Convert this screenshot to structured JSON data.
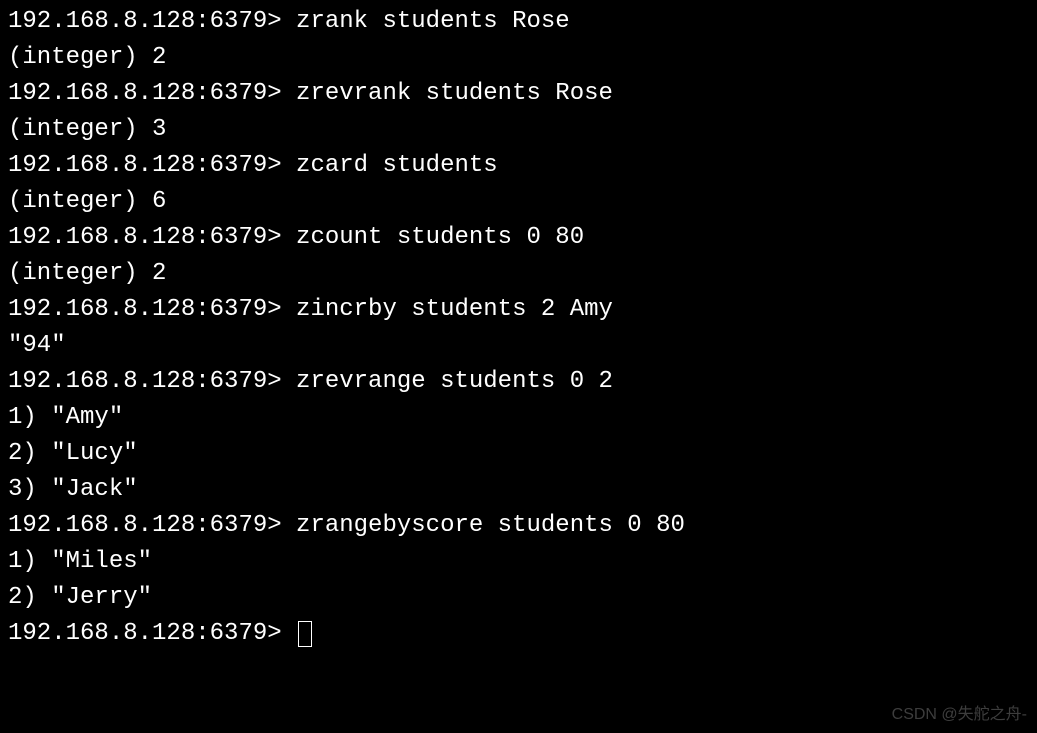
{
  "prompt": "192.168.8.128:6379> ",
  "entries": [
    {
      "command": "zrank students Rose",
      "outputs": [
        "(integer) 2"
      ]
    },
    {
      "command": "zrevrank students Rose",
      "outputs": [
        "(integer) 3"
      ]
    },
    {
      "command": "zcard students",
      "outputs": [
        "(integer) 6"
      ]
    },
    {
      "command": "zcount students 0 80",
      "outputs": [
        "(integer) 2"
      ]
    },
    {
      "command": "zincrby students 2 Amy",
      "outputs": [
        "\"94\""
      ]
    },
    {
      "command": "zrevrange students 0 2",
      "outputs": [
        "1) \"Amy\"",
        "2) \"Lucy\"",
        "3) \"Jack\""
      ]
    },
    {
      "command": "zrangebyscore students 0 80",
      "outputs": [
        "1) \"Miles\"",
        "2) \"Jerry\""
      ]
    }
  ],
  "watermark": "CSDN @失舵之舟-"
}
